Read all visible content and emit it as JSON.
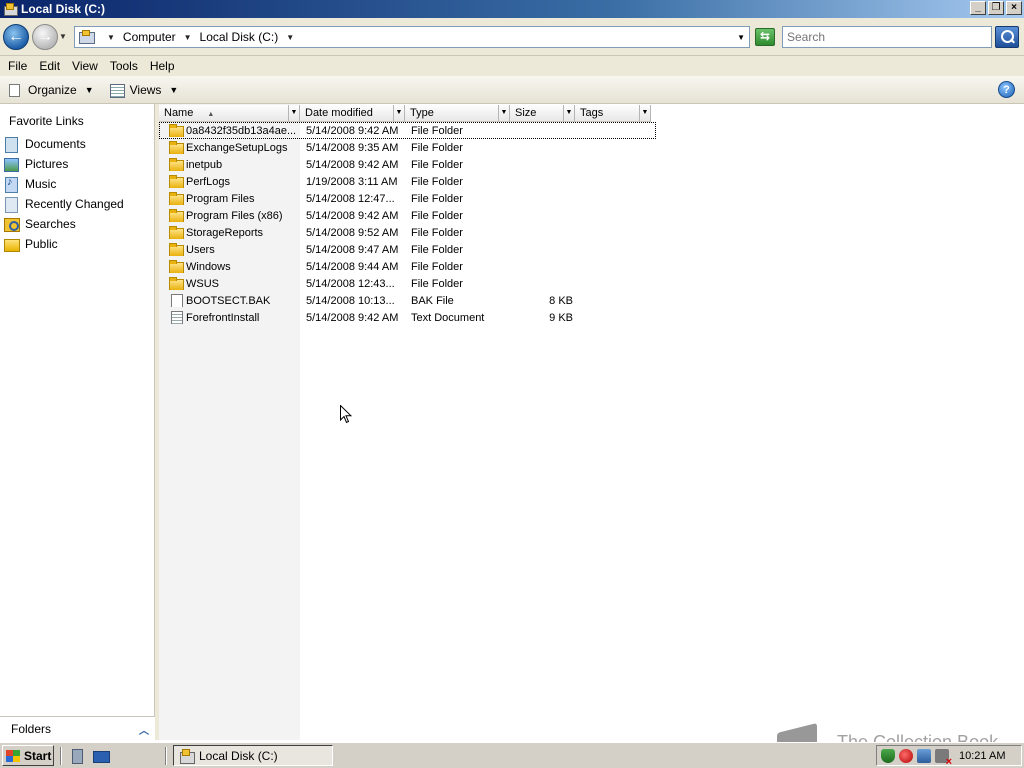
{
  "window": {
    "title": "Local Disk (C:)"
  },
  "address": {
    "crumbs": [
      "Computer",
      "Local Disk (C:)"
    ]
  },
  "search": {
    "placeholder": "Search"
  },
  "menu": [
    "File",
    "Edit",
    "View",
    "Tools",
    "Help"
  ],
  "toolbar": {
    "organize": "Organize",
    "views": "Views",
    "help": "?"
  },
  "nav": {
    "heading": "Favorite Links",
    "items": [
      "Documents",
      "Pictures",
      "Music",
      "Recently Changed",
      "Searches",
      "Public"
    ],
    "folders_label": "Folders"
  },
  "columns": {
    "name": "Name",
    "date": "Date modified",
    "type": "Type",
    "size": "Size",
    "tags": "Tags"
  },
  "files": [
    {
      "name": "0a8432f35db13a4ae...",
      "date": "5/14/2008 9:42 AM",
      "type": "File Folder",
      "size": "",
      "icon": "folder"
    },
    {
      "name": "ExchangeSetupLogs",
      "date": "5/14/2008 9:35 AM",
      "type": "File Folder",
      "size": "",
      "icon": "folder"
    },
    {
      "name": "inetpub",
      "date": "5/14/2008 9:42 AM",
      "type": "File Folder",
      "size": "",
      "icon": "folder"
    },
    {
      "name": "PerfLogs",
      "date": "1/19/2008 3:11 AM",
      "type": "File Folder",
      "size": "",
      "icon": "folder"
    },
    {
      "name": "Program Files",
      "date": "5/14/2008 12:47...",
      "type": "File Folder",
      "size": "",
      "icon": "folder"
    },
    {
      "name": "Program Files (x86)",
      "date": "5/14/2008 9:42 AM",
      "type": "File Folder",
      "size": "",
      "icon": "folder"
    },
    {
      "name": "StorageReports",
      "date": "5/14/2008 9:52 AM",
      "type": "File Folder",
      "size": "",
      "icon": "folder"
    },
    {
      "name": "Users",
      "date": "5/14/2008 9:47 AM",
      "type": "File Folder",
      "size": "",
      "icon": "folder"
    },
    {
      "name": "Windows",
      "date": "5/14/2008 9:44 AM",
      "type": "File Folder",
      "size": "",
      "icon": "folder"
    },
    {
      "name": "WSUS",
      "date": "5/14/2008 12:43...",
      "type": "File Folder",
      "size": "",
      "icon": "folder"
    },
    {
      "name": "BOOTSECT.BAK",
      "date": "5/14/2008 10:13...",
      "type": "BAK File",
      "size": "8 KB",
      "icon": "file"
    },
    {
      "name": "ForefrontInstall",
      "date": "5/14/2008 9:42 AM",
      "type": "Text Document",
      "size": "9 KB",
      "icon": "text"
    }
  ],
  "taskbar": {
    "start": "Start",
    "task": "Local Disk (C:)",
    "clock": "10:21 AM"
  },
  "watermark": "The Collection Book"
}
